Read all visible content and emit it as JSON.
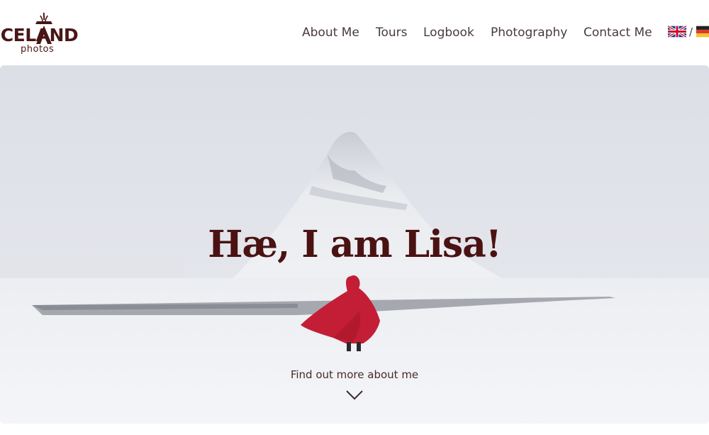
{
  "logo": {
    "word": "ICELAND",
    "sub": "photos"
  },
  "nav": {
    "items": [
      {
        "label": "About Me"
      },
      {
        "label": "Tours"
      },
      {
        "label": "Logbook"
      },
      {
        "label": "Photography"
      },
      {
        "label": "Contact Me"
      }
    ]
  },
  "language": {
    "separator": "/",
    "options": [
      {
        "icon": "uk-flag-icon"
      },
      {
        "icon": "germany-flag-icon"
      }
    ]
  },
  "hero": {
    "title": "Hæ, I am Lisa!",
    "cta_label": "Find out more about me",
    "cta_icon": "chevron-down-icon"
  },
  "colors": {
    "brand": "#4a1616",
    "text": "#4a3a3a",
    "cloak": "#c41e36"
  }
}
